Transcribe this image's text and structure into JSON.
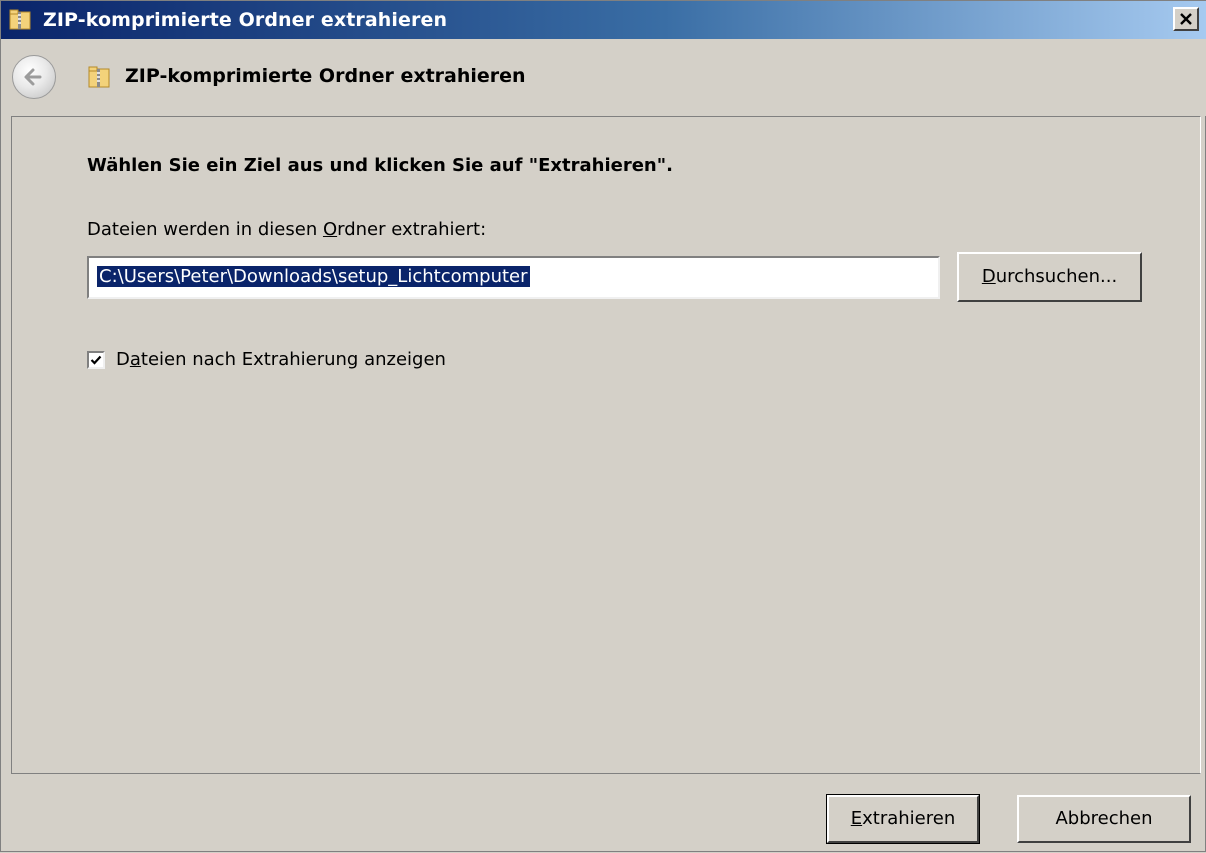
{
  "window": {
    "title": "ZIP-komprimierte Ordner extrahieren",
    "close_label": "×"
  },
  "header": {
    "title": "ZIP-komprimierte Ordner extrahieren"
  },
  "main": {
    "instruction": "Wählen Sie ein Ziel aus und klicken Sie auf \"Extrahieren\".",
    "field_label_prefix": "Dateien werden in diesen ",
    "field_label_mnemonic": "O",
    "field_label_suffix": "rdner extrahiert:",
    "path_value": "C:\\Users\\Peter\\Downloads\\setup_Lichtcomputer",
    "browse_mnemonic": "D",
    "browse_rest": "urchsuchen...",
    "show_files_checked": true,
    "show_files_prefix": "D",
    "show_files_mnemonic": "a",
    "show_files_suffix": "teien nach Extrahierung anzeigen"
  },
  "footer": {
    "extract_mnemonic": "E",
    "extract_rest": "xtrahieren",
    "cancel_label": "Abbrechen"
  },
  "icons": {
    "title": "zip-folder-icon",
    "back": "back-arrow-icon",
    "header": "zip-folder-icon",
    "close": "close-icon",
    "check": "checkmark-icon"
  },
  "colors": {
    "selection": "#0a246a",
    "dialog_bg": "#d4d0c8"
  }
}
